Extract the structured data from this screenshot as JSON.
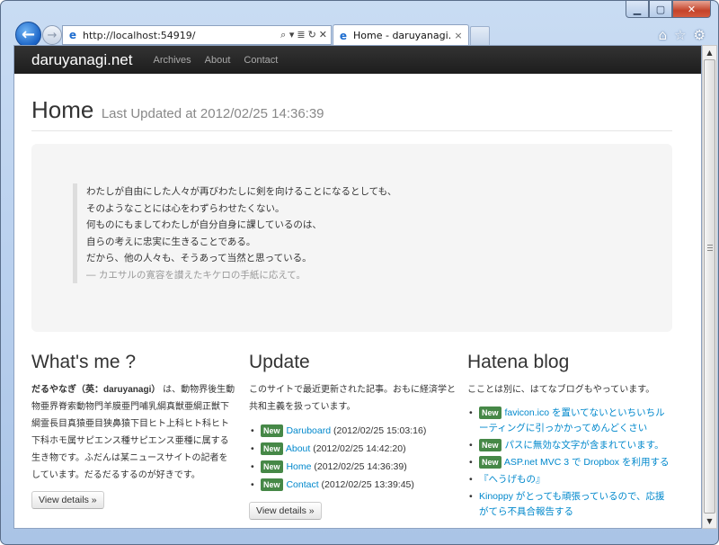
{
  "browser": {
    "url": "http://localhost:54919/",
    "tab_title": "Home - daruyanagi.net",
    "tab_close": "×",
    "back_glyph": "←",
    "forward_glyph": "→",
    "addr_tools": [
      "⌕ ▾",
      "≣",
      "↻",
      "✕"
    ],
    "right_icons": [
      "⌂",
      "☆",
      "⚙"
    ],
    "window_controls": [
      "▁",
      "▢",
      "✕"
    ]
  },
  "site": {
    "brand": "daruyanagi.net",
    "nav": [
      "Archives",
      "About",
      "Contact"
    ]
  },
  "header": {
    "title": "Home",
    "subtitle": "Last Updated at 2012/02/25 14:36:39"
  },
  "hero": {
    "lines": [
      "わたしが自由にした人々が再びわたしに剣を向けることになるとしても、",
      "そのようなことには心をわずらわせたくない。",
      "何ものにもましてわたしが自分自身に課しているのは、",
      "自らの考えに忠実に生きることである。",
      "だから、他の人々も、そうあって当然と思っている。"
    ],
    "cite": "― カエサルの寛容を讃えたキケロの手紙に応えて。"
  },
  "whats_me": {
    "heading": "What's me ?",
    "name": "だるやなぎ（英：daruyanagi）",
    "body": "は、動物界後生動物亜界脊索動物門羊膜亜門哺乳綱真獣亜綱正獣下綱霊長目真猿亜目狭鼻猿下目ヒト上科ヒト科ヒト下科ホモ属サピエンス種サピエンス亜種に属する生き物です。ふだんは某ニュースサイトの記者をしています。だるだるするのが好きです。",
    "button": "View details »"
  },
  "update": {
    "heading": "Update",
    "intro": "このサイトで最近更新された記事。おもに経済学と共和主義を扱っています。",
    "badge": "New",
    "items": [
      {
        "title": "Daruboard",
        "date": "(2012/02/25 15:03:16)"
      },
      {
        "title": "About",
        "date": "(2012/02/25 14:42:20)"
      },
      {
        "title": "Home",
        "date": "(2012/02/25 14:36:39)"
      },
      {
        "title": "Contact",
        "date": "(2012/02/25 13:39:45)"
      }
    ],
    "button": "View details »"
  },
  "hatena": {
    "heading": "Hatena blog",
    "intro": "こことは別に、はてなブログもやっています。",
    "badge": "New",
    "items": [
      {
        "new": true,
        "title": "favicon.ico を置いてないといちいちルーティングに引っかかってめんどくさい"
      },
      {
        "new": true,
        "title": "パスに無効な文字が含まれています。"
      },
      {
        "new": true,
        "title": "ASP.net MVC 3 で Dropbox を利用する"
      },
      {
        "new": false,
        "title": "『へうげもの』"
      },
      {
        "new": false,
        "title": "Kinoppy がとっても頑張っているので、応援がてら不具合報告する"
      }
    ]
  },
  "colors": {
    "navbar": "#222222",
    "link": "#0088cc",
    "label_new": "#468847",
    "hero_bg": "#f5f5f5"
  }
}
